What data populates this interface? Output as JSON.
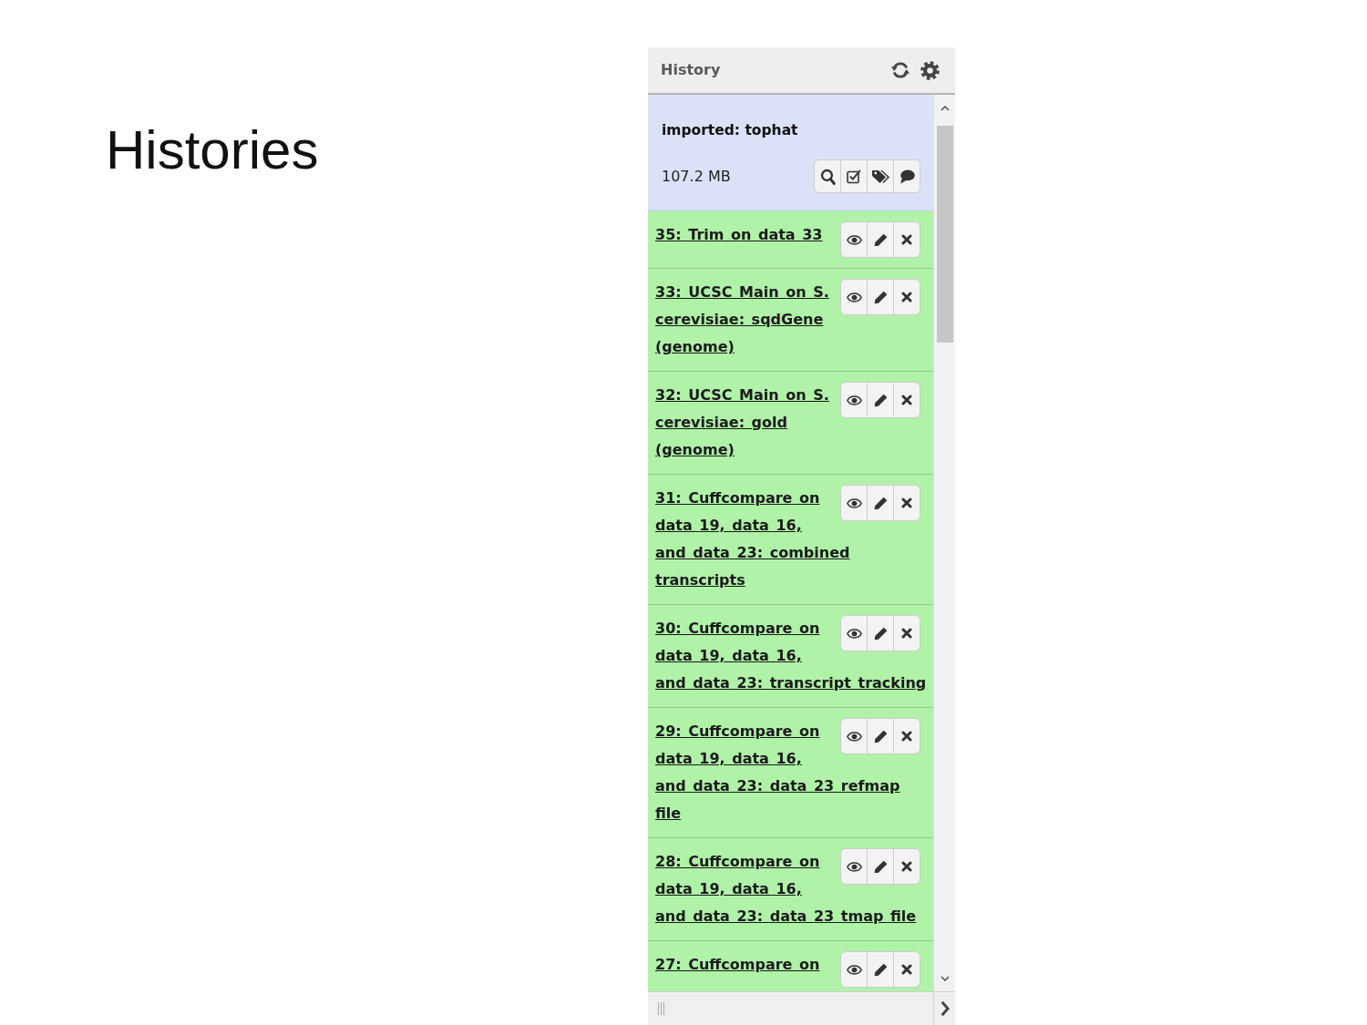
{
  "slide": {
    "title": "Histories"
  },
  "history_panel": {
    "title": "History",
    "history": {
      "name": "imported: tophat",
      "size": "107.2 MB"
    },
    "datasets": [
      {
        "title": "35: Trim on data 33"
      },
      {
        "title": "33: UCSC Main on S. cerevisiae: sqdGene (genome)"
      },
      {
        "title": "32: UCSC Main on S. cerevisiae: gold (genome)"
      },
      {
        "title": "31: Cuffcompare on data 19, data 16, and data 23: combined transcripts"
      },
      {
        "title": "30: Cuffcompare on data 19, data 16, and data 23: transcript tracking"
      },
      {
        "title": "29: Cuffcompare on data 19, data 16, and data 23: data 23 refmap file"
      },
      {
        "title": "28: Cuffcompare on data 19, data 16, and data 23: data 23 tmap file"
      },
      {
        "title": "27: Cuffcompare on"
      }
    ]
  }
}
